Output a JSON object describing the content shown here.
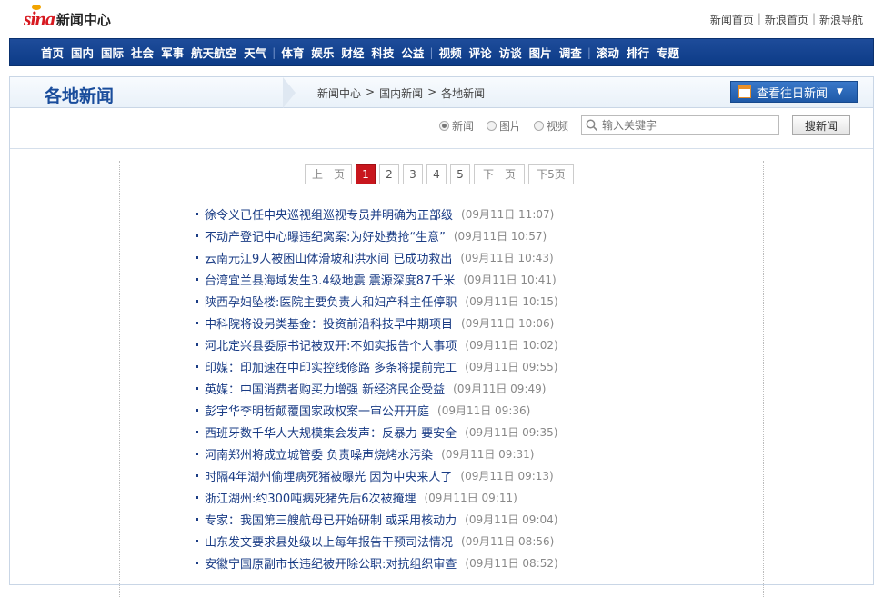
{
  "header": {
    "brand": "sina",
    "section": "新闻中心",
    "links": [
      "新闻首页",
      "新浪首页",
      "新浪导航"
    ]
  },
  "nav": {
    "groups": [
      [
        "首页",
        "国内",
        "国际",
        "社会",
        "军事",
        "航天航空",
        "天气"
      ],
      [
        "体育",
        "娱乐",
        "财经",
        "科技",
        "公益"
      ],
      [
        "视频",
        "评论",
        "访谈",
        "图片",
        "调查"
      ],
      [
        "滚动",
        "排行",
        "专题"
      ]
    ]
  },
  "panel": {
    "title": "各地新闻",
    "breadcrumb": [
      "新闻中心",
      "国内新闻",
      "各地新闻"
    ],
    "history_button": "查看往日新闻"
  },
  "search": {
    "radios": [
      {
        "label": "新闻",
        "checked": true
      },
      {
        "label": "图片",
        "checked": false
      },
      {
        "label": "视频",
        "checked": false
      }
    ],
    "placeholder": "输入关键字",
    "button": "搜新闻"
  },
  "pager": {
    "prev": "上一页",
    "pages": [
      "1",
      "2",
      "3",
      "4",
      "5"
    ],
    "current": "1",
    "next": "下一页",
    "next5": "下5页"
  },
  "news": [
    {
      "title": "徐令义已任中央巡视组巡视专员并明确为正部级",
      "time": "(09月11日 11:07)"
    },
    {
      "title": "不动产登记中心曝违纪窝案:为好处费抢“生意”",
      "time": "(09月11日 10:57)"
    },
    {
      "title": "云南元江9人被困山体滑坡和洪水间 已成功救出",
      "time": "(09月11日 10:43)"
    },
    {
      "title": "台湾宜兰县海域发生3.4级地震 震源深度87千米",
      "time": "(09月11日 10:41)"
    },
    {
      "title": "陕西孕妇坠楼:医院主要负责人和妇产科主任停职",
      "time": "(09月11日 10:15)"
    },
    {
      "title": "中科院将设另类基金：投资前沿科技早中期项目",
      "time": "(09月11日 10:06)"
    },
    {
      "title": "河北定兴县委原书记被双开:不如实报告个人事项",
      "time": "(09月11日 10:02)"
    },
    {
      "title": "印媒：印加速在中印实控线修路 多条将提前完工",
      "time": "(09月11日 09:55)"
    },
    {
      "title": "英媒：中国消费者购买力增强 新经济民企受益",
      "time": "(09月11日 09:49)"
    },
    {
      "title": "彭宇华李明哲颠覆国家政权案一审公开开庭",
      "time": "(09月11日 09:36)"
    },
    {
      "title": "西班牙数千华人大规模集会发声：反暴力 要安全",
      "time": "(09月11日 09:35)"
    },
    {
      "title": "河南郑州将成立城管委 负责噪声烧烤水污染",
      "time": "(09月11日 09:31)"
    },
    {
      "title": "时隔4年湖州偷埋病死猪被曝光 因为中央来人了",
      "time": "(09月11日 09:13)"
    },
    {
      "title": "浙江湖州:约300吨病死猪先后6次被掩埋",
      "time": "(09月11日 09:11)"
    },
    {
      "title": "专家：我国第三艘航母已开始研制 或采用核动力",
      "time": "(09月11日 09:04)"
    },
    {
      "title": "山东发文要求县处级以上每年报告干预司法情况",
      "time": "(09月11日 08:56)"
    },
    {
      "title": "安徽宁国原副市长违纪被开除公职:对抗组织审查",
      "time": "(09月11日 08:52)"
    }
  ]
}
